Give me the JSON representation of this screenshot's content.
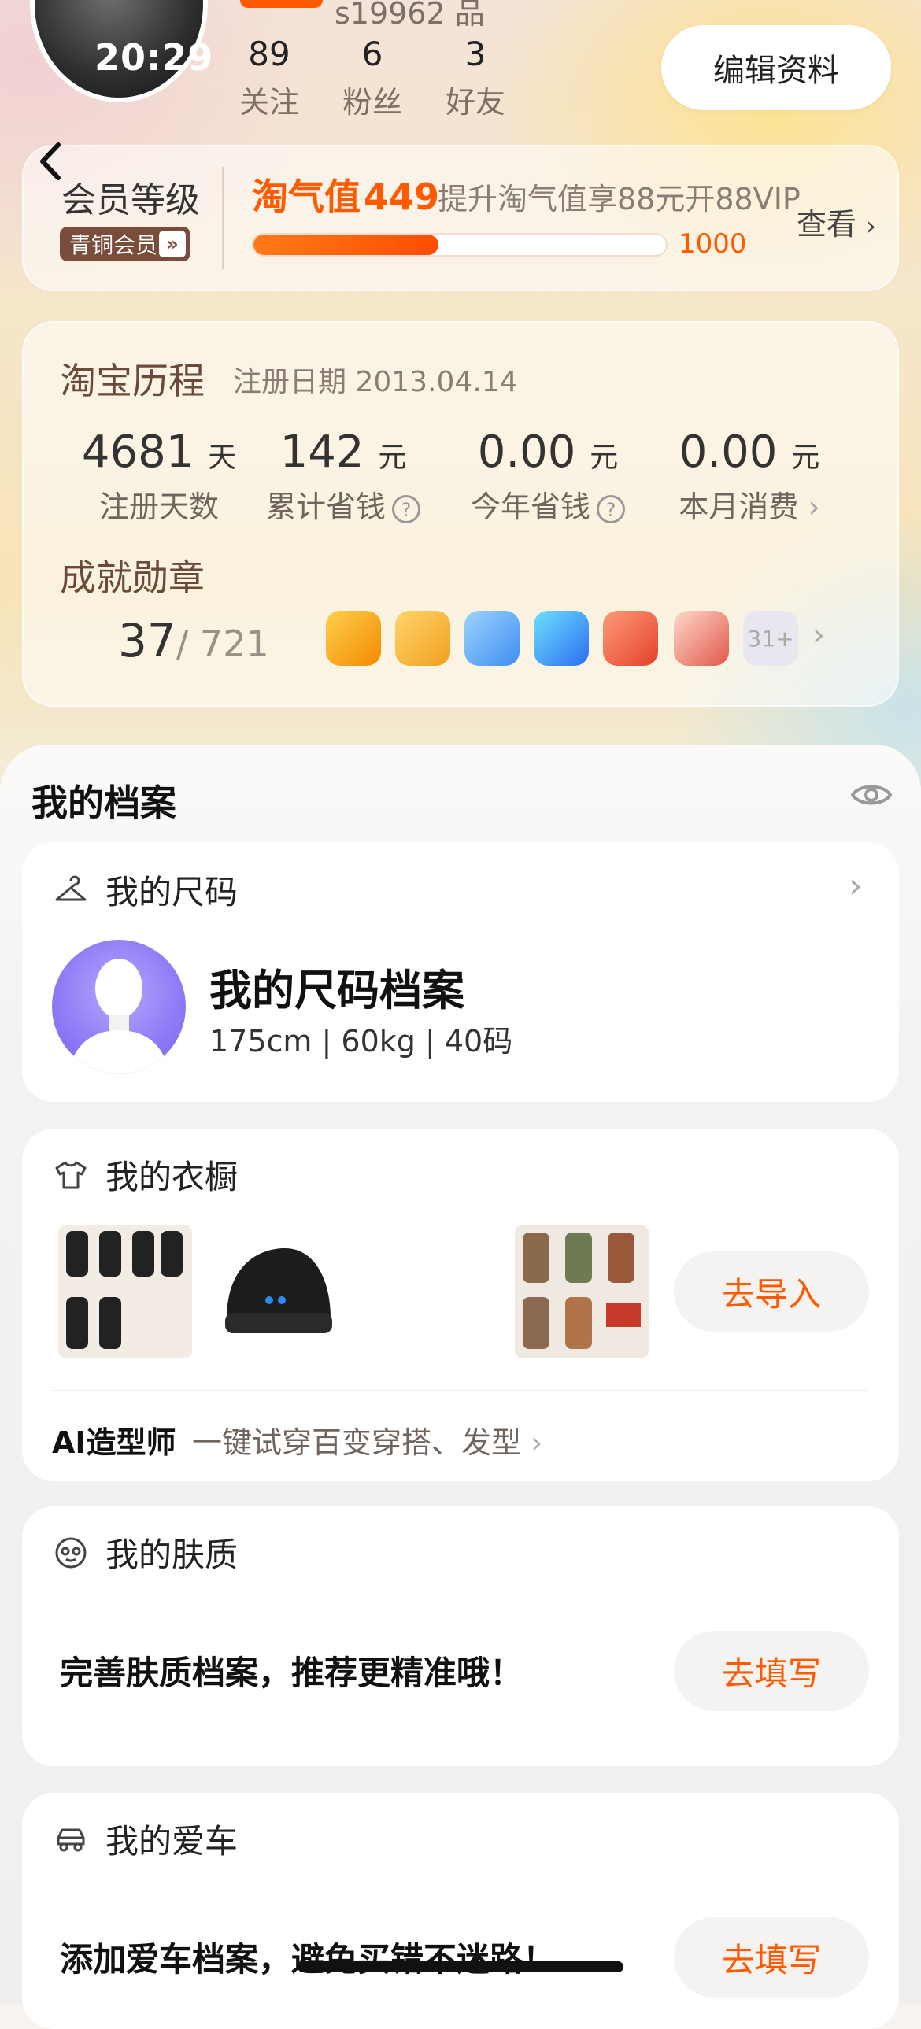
{
  "header": {
    "time": "20:29",
    "partial_text": "s19962 品",
    "edit_label": "编辑资料",
    "stats": [
      {
        "value": "89",
        "label": "关注"
      },
      {
        "value": "6",
        "label": "粉丝"
      },
      {
        "value": "3",
        "label": "好友"
      }
    ]
  },
  "member": {
    "title": "会员等级",
    "badge": "青铜会员",
    "taoqi_label": "淘气值",
    "taoqi_value": "449",
    "hint": "提升淘气值享88元开88VIP",
    "progress_max": "1000",
    "progress_fraction": 0.449,
    "view": "查看",
    "accent": "#ff5a00"
  },
  "journey": {
    "title": "淘宝历程",
    "reg_date": "注册日期 2013.04.14",
    "metrics": [
      {
        "value": "4681",
        "unit": "天",
        "label": "注册天数"
      },
      {
        "value": "142",
        "unit": "元",
        "label": "累计省钱"
      },
      {
        "value": "0.00",
        "unit": "元",
        "label": "今年省钱"
      },
      {
        "value": "0.00",
        "unit": "元",
        "label": "本月消费"
      }
    ],
    "achievements_title": "成就勋章",
    "ach_count": "37",
    "ach_total": "/ 721",
    "more_medals": "31+"
  },
  "profile": {
    "title": "我的档案",
    "size": {
      "head": "我的尺码",
      "card_title": "我的尺码档案",
      "card_sub": "175cm | 60kg | 40码"
    },
    "wardrobe": {
      "head": "我的衣橱",
      "import_label": "去导入",
      "ai_label": "AI造型师",
      "ai_desc": "一键试穿百变穿搭、发型"
    },
    "skin": {
      "head": "我的肤质",
      "prompt": "完善肤质档案，推荐更精准哦！",
      "button": "去填写"
    },
    "car": {
      "head": "我的爱车",
      "prompt": "添加爱车档案，避免买错不迷路！",
      "button": "去填写"
    }
  }
}
